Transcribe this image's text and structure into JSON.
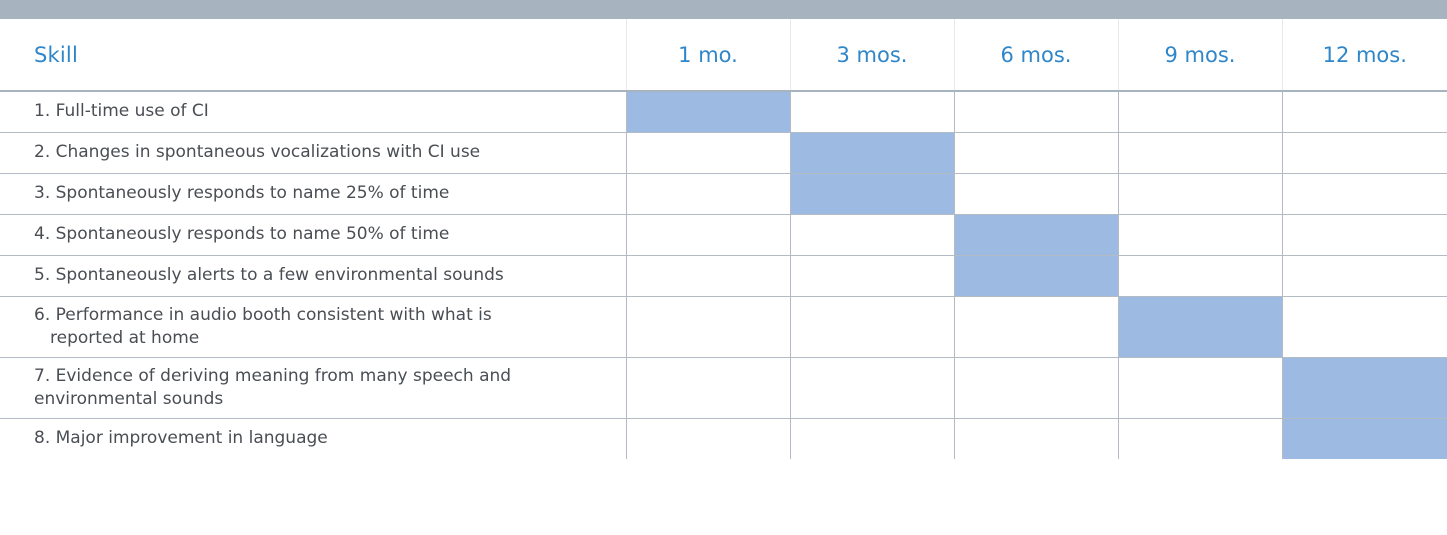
{
  "table": {
    "headers": {
      "skill": "Skill",
      "months": [
        "1 mo.",
        "3 mos.",
        "6 mos.",
        "9 mos.",
        "12 mos."
      ]
    },
    "rows": [
      {
        "skill": "1. Full-time use of CI",
        "cont": "",
        "filled_month_index": 0
      },
      {
        "skill": "2. Changes in spontaneous vocalizations with CI use",
        "cont": "",
        "filled_month_index": 1
      },
      {
        "skill": "3. Spontaneously responds to name 25% of time",
        "cont": "",
        "filled_month_index": 1
      },
      {
        "skill": "4. Spontaneously responds to name 50% of time",
        "cont": "",
        "filled_month_index": 2
      },
      {
        "skill": "5. Spontaneously alerts to a few environmental sounds",
        "cont": "",
        "filled_month_index": 2
      },
      {
        "skill": "6. Performance in audio booth consistent with what is",
        "cont": "reported at home",
        "filled_month_index": 3
      },
      {
        "skill": "7. Evidence of deriving meaning from many speech and",
        "cont": "environmental sounds",
        "filled_month_index": 4
      },
      {
        "skill": "8. Major improvement in language",
        "cont": "",
        "filled_month_index": 4
      }
    ]
  },
  "colors": {
    "header_text": "#2f86c8",
    "filled_cell": "#9dbbe2",
    "top_band": "#a7b3be"
  }
}
